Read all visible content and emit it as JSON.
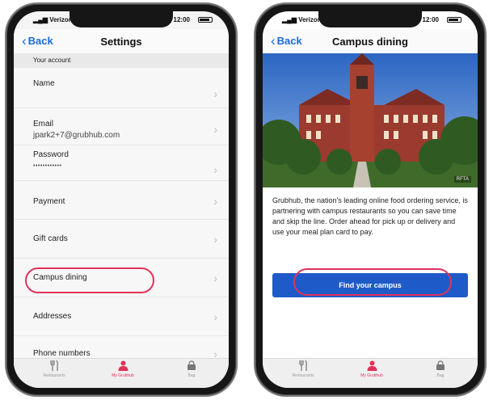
{
  "status_bar": {
    "carrier": "Verizon",
    "time": "12:00"
  },
  "settings_screen": {
    "back_label": "Back",
    "title": "Settings",
    "section_header": "Your account",
    "rows": [
      {
        "label": "Name"
      },
      {
        "label": "Email",
        "value": "jpark2+7@grubhub.com"
      },
      {
        "label": "Password",
        "value": "••••••••••••"
      },
      {
        "label": "Payment"
      },
      {
        "label": "Gift cards"
      },
      {
        "label": "Campus dining"
      },
      {
        "label": "Addresses"
      },
      {
        "label": "Phone numbers"
      }
    ]
  },
  "campus_screen": {
    "back_label": "Back",
    "title": "Campus dining",
    "image_credit": "RFTA",
    "description": "Grubhub, the nation's leading online food ordering service, is partnering with campus restaurants so you can save time and skip the line. Order ahead for pick up or delivery and use your meal plan card to pay.",
    "cta_label": "Find your campus"
  },
  "tab_bar": {
    "tabs": [
      {
        "label": "Restaurants",
        "icon": "fork-knife-icon"
      },
      {
        "label": "My Grubhub",
        "icon": "person-icon",
        "active": true
      },
      {
        "label": "Bag",
        "icon": "bag-icon"
      }
    ]
  },
  "colors": {
    "accent_blue": "#1f5bc8",
    "link_blue": "#1a6ad6",
    "highlight_red": "#e0325a"
  }
}
